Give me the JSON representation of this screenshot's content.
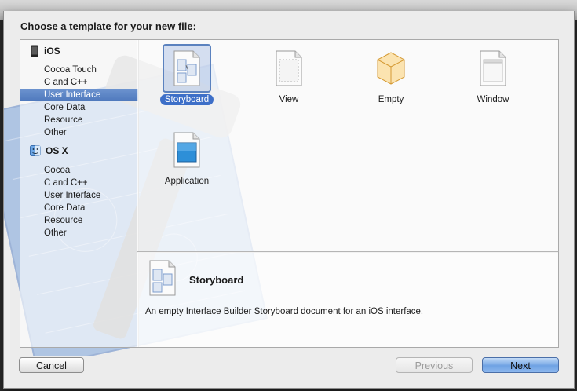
{
  "sheet": {
    "title": "Choose a template for your new file:"
  },
  "sidebar": {
    "groups": [
      {
        "label": "iOS",
        "icon": "iphone-icon",
        "items": [
          "Cocoa Touch",
          "C and C++",
          "User Interface",
          "Core Data",
          "Resource",
          "Other"
        ],
        "selected": "User Interface"
      },
      {
        "label": "OS X",
        "icon": "mac-finder-icon",
        "items": [
          "Cocoa",
          "C and C++",
          "User Interface",
          "Core Data",
          "Resource",
          "Other"
        ]
      }
    ]
  },
  "templates": [
    {
      "label": "Storyboard",
      "icon": "storyboard-document-icon",
      "selected": true
    },
    {
      "label": "View",
      "icon": "view-document-icon"
    },
    {
      "label": "Empty",
      "icon": "empty-cube-icon"
    },
    {
      "label": "Window",
      "icon": "window-document-icon"
    },
    {
      "label": "Application",
      "icon": "application-document-icon"
    }
  ],
  "detail": {
    "title": "Storyboard",
    "icon": "storyboard-document-icon",
    "description": "An empty Interface Builder Storyboard document for an iOS interface."
  },
  "buttons": {
    "cancel": "Cancel",
    "previous": "Previous",
    "next": "Next"
  },
  "colors": {
    "selection": "#4f79bd",
    "primary_button": "#6fa2e3"
  }
}
